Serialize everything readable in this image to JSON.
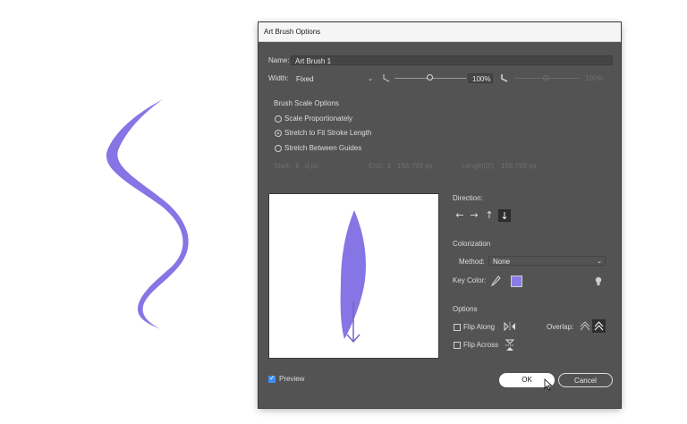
{
  "dialog": {
    "title": "Art Brush Options"
  },
  "name": {
    "label": "Name:",
    "value": "Art Brush 1"
  },
  "width": {
    "label": "Width:",
    "select_value": "Fixed",
    "value_percent": "100%",
    "max_percent": "100%",
    "slider_level": 0.5
  },
  "scale": {
    "heading": "Brush Scale Options",
    "options": [
      "Scale Proportionately",
      "Stretch to Fit Stroke Length",
      "Stretch Between Guides"
    ],
    "selected_index": 1
  },
  "guides": {
    "start_label": "Start:",
    "start_value": "0 px",
    "end_label": "End:",
    "end_value": "156,799 px",
    "length_label": "Length(X):",
    "length_value": "156,799 px"
  },
  "direction": {
    "label": "Direction:",
    "arrows": [
      "←",
      "→",
      "↑",
      "↓"
    ],
    "selected_index": 3
  },
  "colorization": {
    "heading": "Colorization",
    "method_label": "Method:",
    "method_value": "None",
    "key_color_label": "Key Color:",
    "key_color": "#8a7ce6"
  },
  "options": {
    "heading": "Options",
    "flip_along": "Flip Along",
    "flip_across": "Flip Across",
    "overlap_label": "Overlap:"
  },
  "preview": {
    "label": "Preview",
    "checked": true
  },
  "buttons": {
    "ok": "OK",
    "cancel": "Cancel"
  },
  "colors": {
    "brush": "#8675e4",
    "arrow": "#6f68c9",
    "dialog_bg": "#535353",
    "accent": "#3d8ef0"
  }
}
